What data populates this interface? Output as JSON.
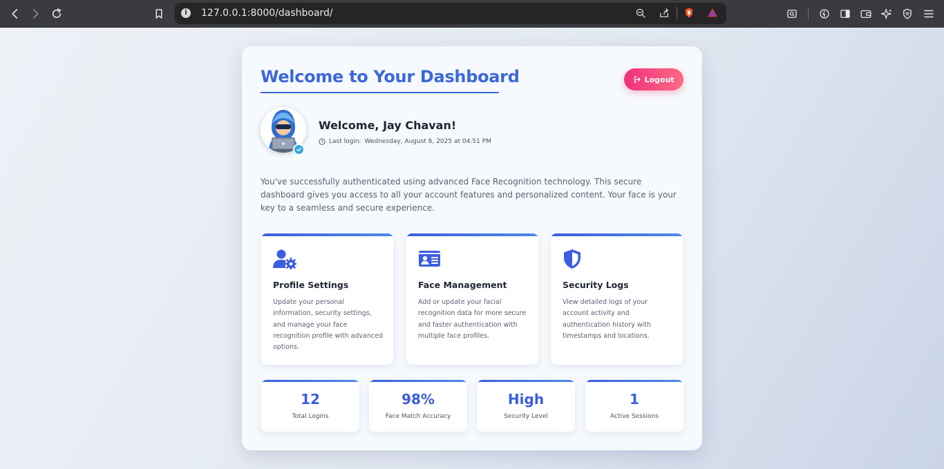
{
  "browser": {
    "url": "127.0.0.1:8000/dashboard/",
    "info_glyph": "i"
  },
  "dashboard": {
    "title": "Welcome to Your Dashboard",
    "logout_label": "Logout",
    "welcome": "Welcome, Jay Chavan!",
    "last_login_label": "Last login:",
    "last_login_value": "Wednesday, August 6, 2025 at 04:51 PM",
    "intro": "You've successfully authenticated using advanced Face Recognition technology. This secure dashboard gives you access to all your account features and personalized content. Your face is your key to a seamless and secure experience."
  },
  "features": [
    {
      "icon": "user-gear-icon",
      "title": "Profile Settings",
      "description": "Update your personal information, security settings, and manage your face recognition profile with advanced options."
    },
    {
      "icon": "id-card-icon",
      "title": "Face Management",
      "description": "Add or update your facial recognition data for more secure and faster authentication with multiple face profiles."
    },
    {
      "icon": "shield-icon",
      "title": "Security Logs",
      "description": "View detailed logs of your account activity and authentication history with timestamps and locations."
    }
  ],
  "stats": [
    {
      "value": "12",
      "label": "Total Logins"
    },
    {
      "value": "98%",
      "label": "Face Match Accuracy"
    },
    {
      "value": "High",
      "label": "Security Level"
    },
    {
      "value": "1",
      "label": "Active Sessions"
    }
  ],
  "colors": {
    "accent": "#3b68d9",
    "logout": "#f0317b",
    "verified": "#32a8e2",
    "chrome": "#3b3b3f"
  }
}
